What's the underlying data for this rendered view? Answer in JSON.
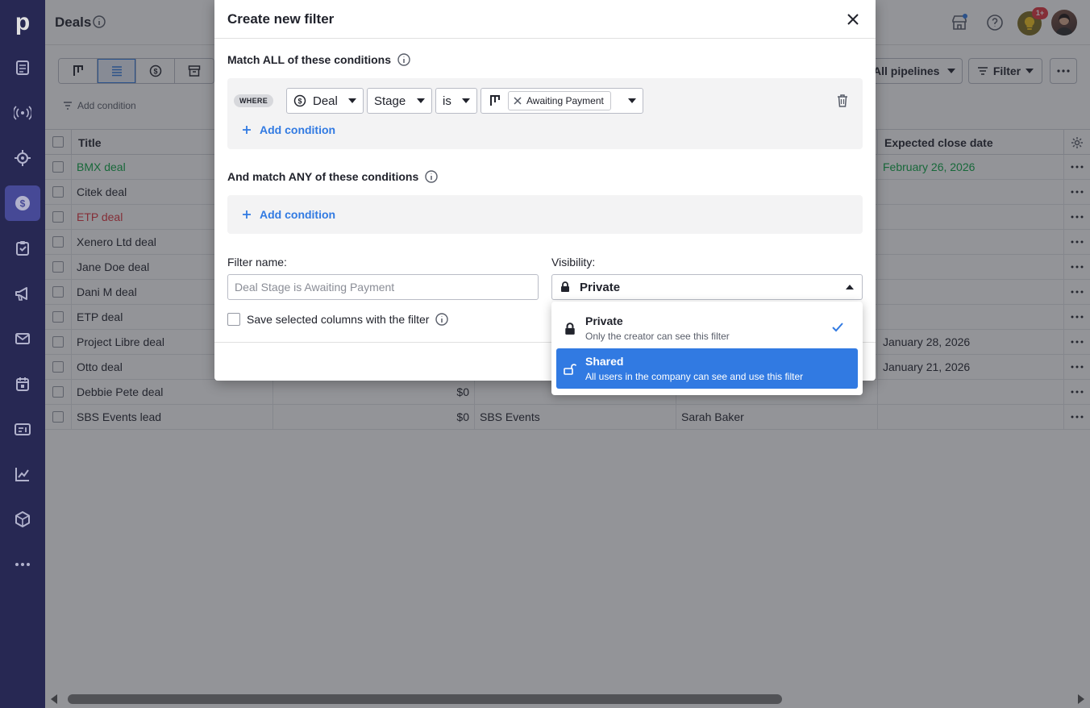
{
  "app": {
    "logo": "p"
  },
  "header": {
    "title": "Deals",
    "notif_count": "1+"
  },
  "toolbar": {
    "add_condition": "Add condition",
    "pipelines": "All pipelines",
    "filter": "Filter"
  },
  "table": {
    "columns": [
      "Title",
      "Expected close date"
    ],
    "rows": [
      {
        "title": "BMX deal",
        "value": "",
        "org": "",
        "person": "",
        "close": "February 26, 2026",
        "color": "#08a742"
      },
      {
        "title": "Citek deal",
        "value": "",
        "org": "",
        "person": "",
        "close": "",
        "color": ""
      },
      {
        "title": "ETP deal",
        "value": "",
        "org": "",
        "person": "",
        "close": "",
        "color": "#e0323c"
      },
      {
        "title": "Xenero Ltd deal",
        "value": "",
        "org": "",
        "person": "",
        "close": "",
        "color": ""
      },
      {
        "title": "Jane Doe deal",
        "value": "",
        "org": "",
        "person": "",
        "close": "",
        "color": ""
      },
      {
        "title": "Dani M deal",
        "value": "",
        "org": "",
        "person": "",
        "close": "",
        "color": ""
      },
      {
        "title": "ETP deal",
        "value": "",
        "org": "",
        "person": "",
        "close": "",
        "color": ""
      },
      {
        "title": "Project Libre deal",
        "value": "",
        "org": "",
        "person": "",
        "close": "January 28, 2026",
        "color": ""
      },
      {
        "title": "Otto deal",
        "value": "",
        "org": "",
        "person": "",
        "close": "January 21, 2026",
        "color": ""
      },
      {
        "title": "Debbie Pete deal",
        "value": "$0",
        "org": "",
        "person": "",
        "close": "",
        "color": ""
      },
      {
        "title": "SBS Events lead",
        "value": "$0",
        "org": "SBS Events",
        "person": "Sarah Baker",
        "close": "",
        "color": ""
      }
    ]
  },
  "modal": {
    "title": "Create new filter",
    "match_all": "Match ALL of these conditions",
    "where": "WHERE",
    "condition": {
      "entity": "Deal",
      "field": "Stage",
      "operator": "is",
      "value": "Awaiting Payment"
    },
    "add_condition": "Add condition",
    "match_any": "And match ANY of these conditions",
    "filter_name_label": "Filter name:",
    "filter_name_placeholder": "Deal Stage is Awaiting Payment",
    "visibility_label": "Visibility:",
    "visibility_value": "Private",
    "save_columns": "Save selected columns with the filter"
  },
  "visibility_options": [
    {
      "title": "Private",
      "desc": "Only the creator can see this filter"
    },
    {
      "title": "Shared",
      "desc": "All users in the company can see and use this filter"
    }
  ],
  "colors": {
    "sidebar": "#27285a",
    "accent": "#317ae2",
    "won": "#08a742",
    "lost": "#e0323c"
  }
}
